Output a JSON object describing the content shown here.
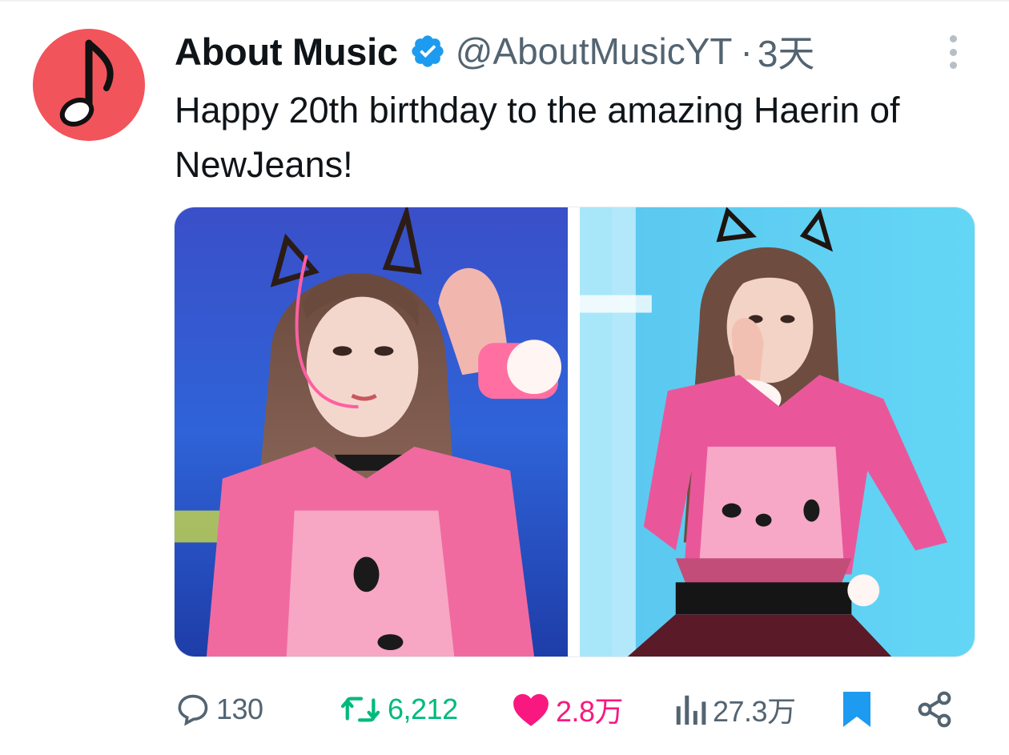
{
  "account": {
    "display_name": "About Music",
    "handle": "@AboutMusicYT",
    "separator": "·",
    "time": "3天",
    "avatar_icon": "music-note-icon",
    "verified_icon": "verified-badge-icon"
  },
  "tweet": {
    "text": "Happy 20th birthday to the amazing Haerin of NewJeans!",
    "media": [
      {
        "kind": "photo",
        "icon": "photo-left"
      },
      {
        "kind": "photo",
        "icon": "photo-right"
      }
    ]
  },
  "actions": {
    "reply_count": "130",
    "retweet_count": "6,212",
    "like_count": "2.8万",
    "view_count": "27.3万"
  },
  "colors": {
    "avatar_bg": "#f2545b",
    "verified_blue": "#1d9bf0",
    "retweet_green": "#00ba7c",
    "like_pink": "#f91880",
    "muted_gray": "#536471"
  }
}
